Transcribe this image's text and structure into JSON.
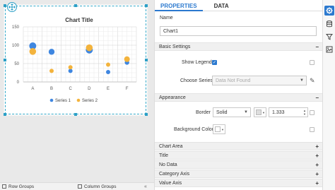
{
  "chart_data": {
    "type": "scatter",
    "title": "Chart Title",
    "categories": [
      "A",
      "B",
      "C",
      "D",
      "E",
      "F"
    ],
    "y_ticks": [
      "0",
      "50",
      "100",
      "150"
    ],
    "ylim": [
      0,
      150
    ],
    "grid": true,
    "legend": "bottom",
    "series": [
      {
        "name": "Series 1",
        "color": "#3e86e0",
        "values": [
          98,
          82,
          30,
          87,
          27,
          53
        ]
      },
      {
        "name": "Series 2",
        "color": "#f3b33c",
        "values": [
          83,
          30,
          40,
          93,
          47,
          62
        ]
      }
    ]
  },
  "bottom_bar": {
    "row_groups": "Row Groups",
    "column_groups": "Column Groups"
  },
  "panel": {
    "tabs": [
      "PROPERTIES",
      "DATA"
    ],
    "name_label": "Name",
    "name_value": "Chart1",
    "basic_settings": "Basic Settings",
    "show_legend": "Show Legend",
    "choose_series": "Choose Series",
    "choose_series_placeholder": "Data Not Found",
    "appearance": "Appearance",
    "border_label": "Border",
    "border_style": "Solid",
    "border_width": "1.333",
    "background_color": "Background Color",
    "sections": [
      "Chart Area",
      "Title",
      "No Data",
      "Category Axis",
      "Value Axis"
    ]
  },
  "icons": [
    "settings-icon",
    "database-icon",
    "filter-icon",
    "image-settings-icon"
  ]
}
